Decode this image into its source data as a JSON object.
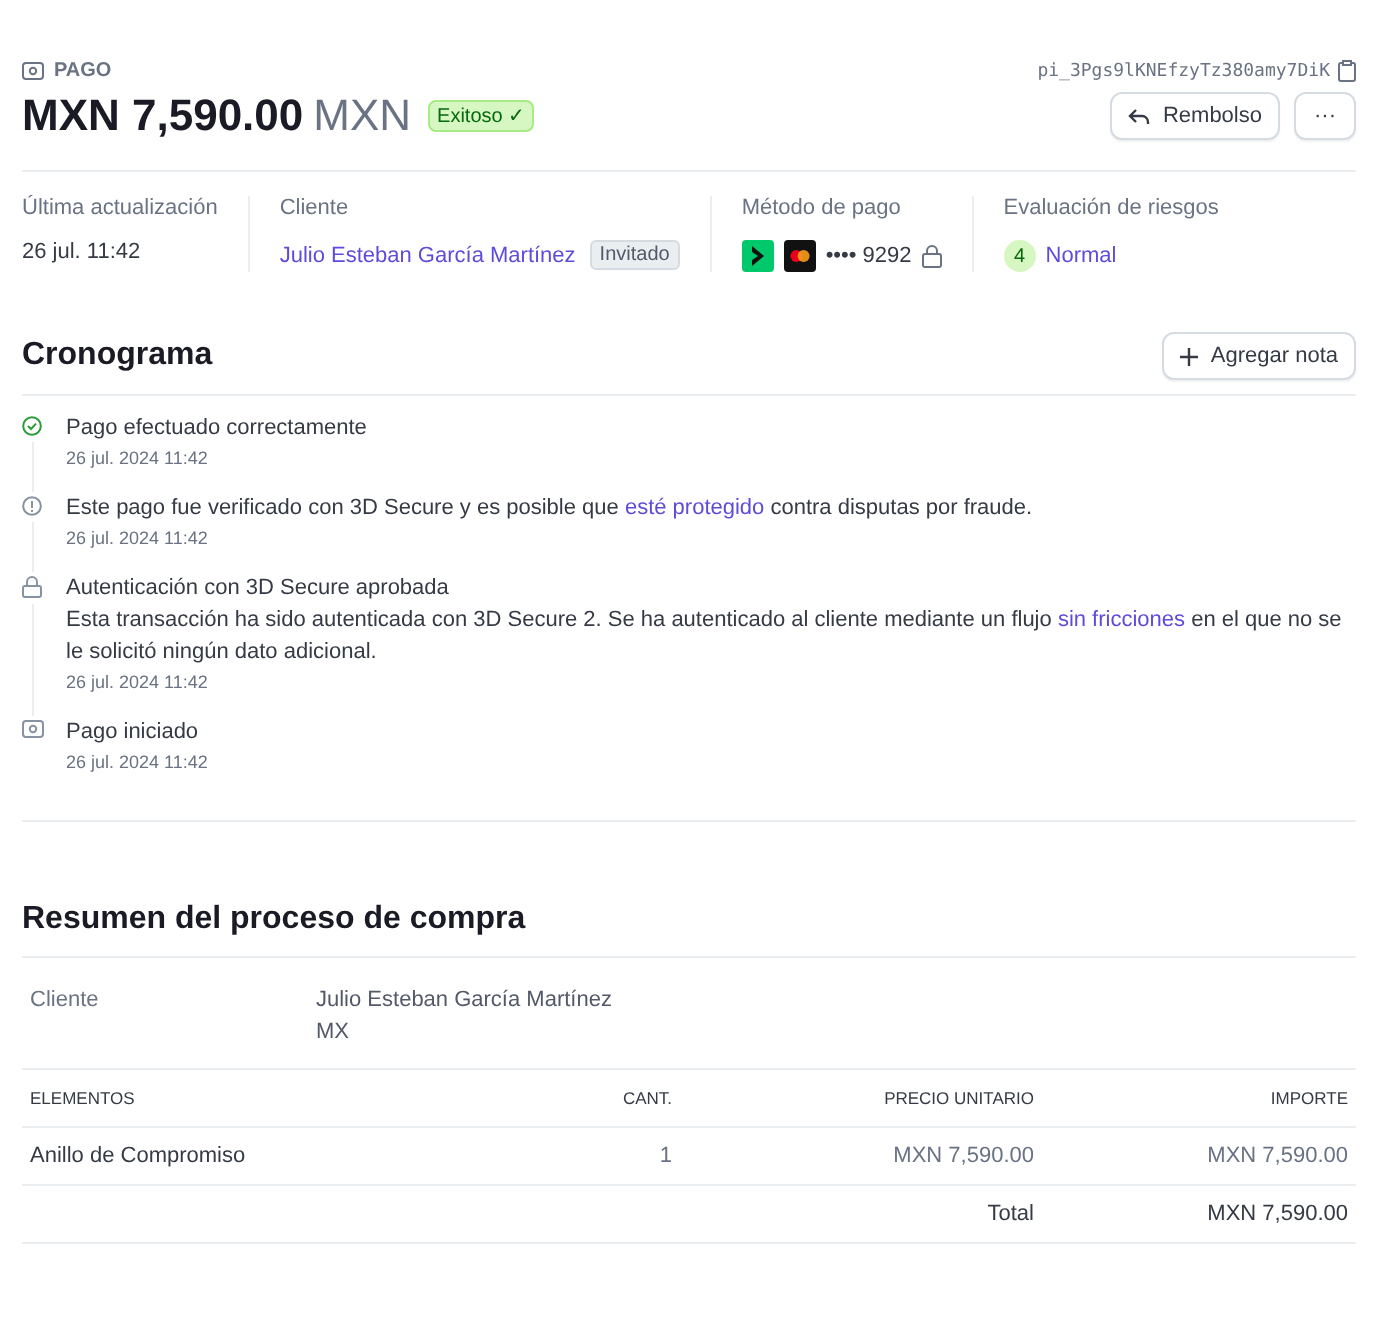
{
  "header": {
    "label": "PAGO",
    "payment_id": "pi_3Pgs9lKNEfzyTz380amy7DiK",
    "amount": "MXN 7,590.00",
    "currency": "MXN",
    "status": "Exitoso ✓",
    "buttons": [
      {
        "kind": "refund",
        "label": "Rembolso"
      },
      {
        "kind": "more",
        "label": "···"
      }
    ]
  },
  "summary": [
    {
      "label": "Última actualización",
      "kind": "text",
      "value": "26 jul. 11:42"
    },
    {
      "label": "Cliente",
      "kind": "customer",
      "value": "Julio Esteban García Martínez",
      "badge": "Invitado"
    },
    {
      "label": "Método de pago",
      "kind": "card",
      "value": "•••• 9292"
    },
    {
      "label": "Evaluación de riesgos",
      "kind": "risk",
      "score": "4",
      "value": "Normal"
    }
  ],
  "timeline": {
    "title": "Cronograma",
    "button": "Agregar nota",
    "events": [
      {
        "kind": "check",
        "parts": [
          {
            "kind": "text",
            "text": "Pago efectuado correctamente"
          }
        ],
        "date": "26 jul. 2024 11:42"
      },
      {
        "kind": "info",
        "parts": [
          {
            "kind": "text",
            "text": "Este pago fue verificado con 3D Secure y es posible que "
          },
          {
            "kind": "link",
            "text": "esté protegido"
          },
          {
            "kind": "text",
            "text": " contra disputas por fraude."
          }
        ],
        "date": "26 jul. 2024 11:42"
      },
      {
        "kind": "lock",
        "parts": [
          {
            "kind": "text",
            "text": "Autenticación con 3D Secure aprobada"
          }
        ],
        "detail": [
          {
            "kind": "text",
            "text": "Esta transacción ha sido autenticada con 3D Secure 2. Se ha autenticado al cliente mediante un flujo "
          },
          {
            "kind": "link",
            "text": "sin fricciones"
          },
          {
            "kind": "text",
            "text": " en el que no se le solicitó ningún dato adicional."
          }
        ],
        "date": "26 jul. 2024 11:42"
      },
      {
        "kind": "payment",
        "parts": [
          {
            "kind": "text",
            "text": "Pago iniciado"
          }
        ],
        "date": "26 jul. 2024 11:42"
      }
    ]
  },
  "checkout": {
    "title": "Resumen del proceso de compra",
    "customer_label": "Cliente",
    "customer_lines": [
      "Julio Esteban García Martínez",
      "MX"
    ],
    "columns": [
      "ELEMENTOS",
      "CANT.",
      "PRECIO UNITARIO",
      "IMPORTE"
    ],
    "rows": [
      [
        "Anillo de Compromiso",
        "1",
        "MXN 7,590.00",
        "MXN 7,590.00"
      ]
    ],
    "total_label": "Total",
    "total": "MXN 7,590.00"
  }
}
